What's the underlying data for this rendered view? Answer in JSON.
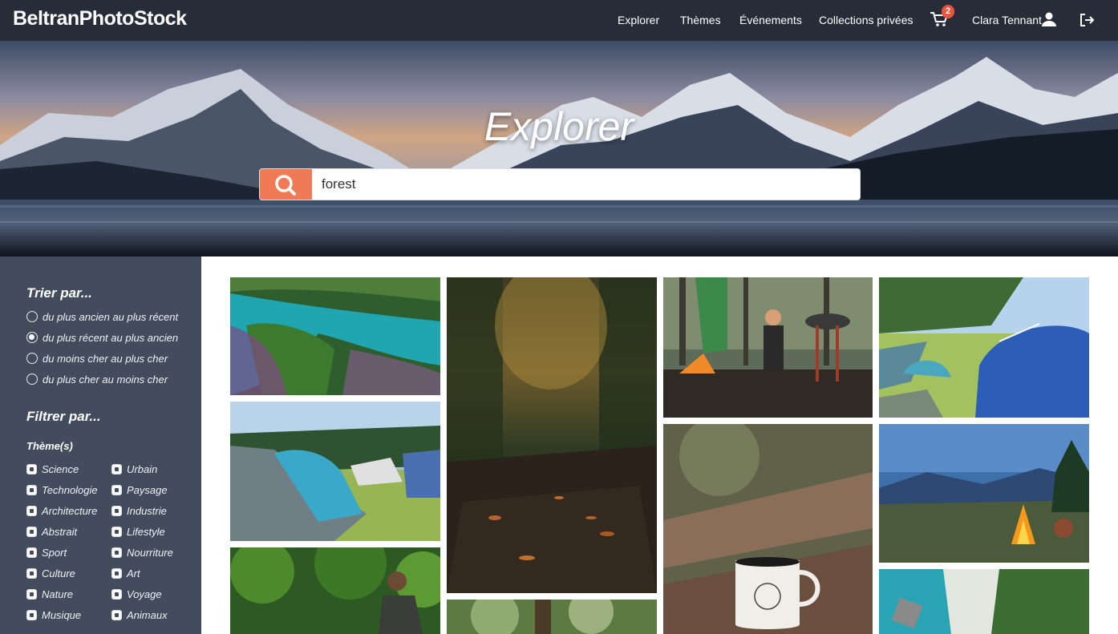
{
  "navbar": {
    "brand": "BeltranPhotoStock",
    "links": [
      "Explorer",
      "Thèmes",
      "Événements",
      "Collections privées"
    ],
    "cart_count": "2",
    "user_name": "Clara Tennant"
  },
  "hero": {
    "title": "Explorer",
    "search_value": "forest"
  },
  "sidebar": {
    "sort_heading": "Trier par...",
    "sort_options": [
      {
        "label": "du plus ancien au plus récent",
        "selected": false
      },
      {
        "label": "du plus récent au plus ancien",
        "selected": true
      },
      {
        "label": "du moins cher au plus cher",
        "selected": false
      },
      {
        "label": "du plus cher au moins cher",
        "selected": false
      }
    ],
    "filter_heading": "Filtrer par...",
    "themes_label": "Thème(s)",
    "themes": [
      "Science",
      "Urbain",
      "Technologie",
      "Paysage",
      "Architecture",
      "Industrie",
      "Abstrait",
      "Lifestyle",
      "Sport",
      "Nourriture",
      "Culture",
      "Art",
      "Nature",
      "Voyage",
      "Musique",
      "Animaux"
    ]
  },
  "gallery": {
    "photos": [
      {
        "subject": "aerial-lagoon"
      },
      {
        "subject": "forest-path"
      },
      {
        "subject": "campfire-friends"
      },
      {
        "subject": "tent-field"
      },
      {
        "subject": "camping-tents"
      },
      {
        "subject": "mug-on-log"
      },
      {
        "subject": "mountain-campfire"
      },
      {
        "subject": "hiker-jungle"
      },
      {
        "subject": "blurry-trees"
      },
      {
        "subject": "aerial-beach"
      }
    ]
  },
  "colors": {
    "navbar": "#262c38",
    "sidebar": "#424c5c",
    "accent": "#f07a56",
    "badge": "#e8553f"
  }
}
